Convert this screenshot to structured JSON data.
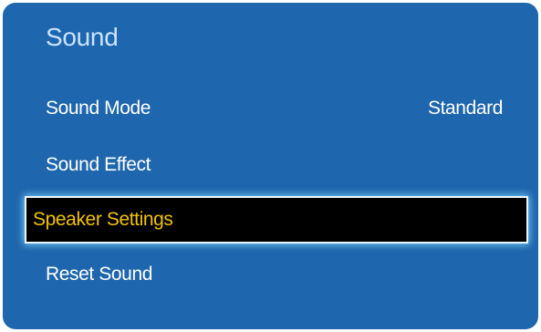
{
  "menu": {
    "title": "Sound",
    "items": [
      {
        "label": "Sound Mode",
        "value": "Standard"
      },
      {
        "label": "Sound Effect"
      },
      {
        "label": "Speaker Settings",
        "selected": true
      },
      {
        "label": "Reset Sound"
      }
    ]
  },
  "colors": {
    "panel_background": "#1e66ad",
    "title_text": "#c9e4ff",
    "item_text": "#ffffff",
    "selected_background": "#000000",
    "selected_text": "#f2c200",
    "selected_glow": "#7fd0ff"
  }
}
